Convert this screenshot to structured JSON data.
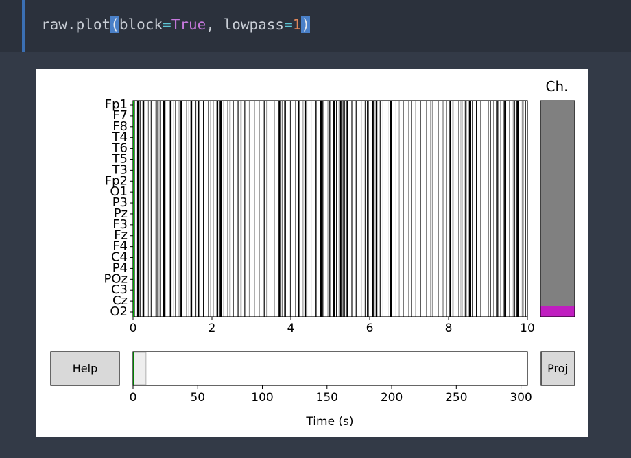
{
  "code_cell": {
    "func": "raw.plot",
    "open_paren": "(",
    "arg1_name": "block",
    "eq1": "=",
    "arg1_value": "True",
    "comma": ", ",
    "arg2_name": "lowpass",
    "eq2": "=",
    "arg2_value": "1",
    "close_paren": ")"
  },
  "figure": {
    "channel_panel_title": "Ch.",
    "help_button": "Help",
    "proj_button": "Proj",
    "channels": [
      "Fp1",
      "F7",
      "F8",
      "T4",
      "T6",
      "T5",
      "T3",
      "Fp2",
      "O1",
      "P3",
      "Pz",
      "F3",
      "Fz",
      "F4",
      "C4",
      "P4",
      "POz",
      "C3",
      "Cz",
      "O2"
    ],
    "time_xlim": [
      0,
      10
    ],
    "time_ticks": [
      "0",
      "2",
      "4",
      "6",
      "8",
      "10"
    ],
    "overview_xlabel": "Time (s)",
    "overview_xlim": [
      0,
      305
    ],
    "overview_ticks": [
      "0",
      "50",
      "100",
      "150",
      "200",
      "250",
      "300"
    ],
    "overview_window": [
      0,
      10
    ],
    "colors": {
      "trace_axis": "#00aa00",
      "scroll_bar": "#808080",
      "scroll_bar_selected": "#c01ec0"
    }
  }
}
